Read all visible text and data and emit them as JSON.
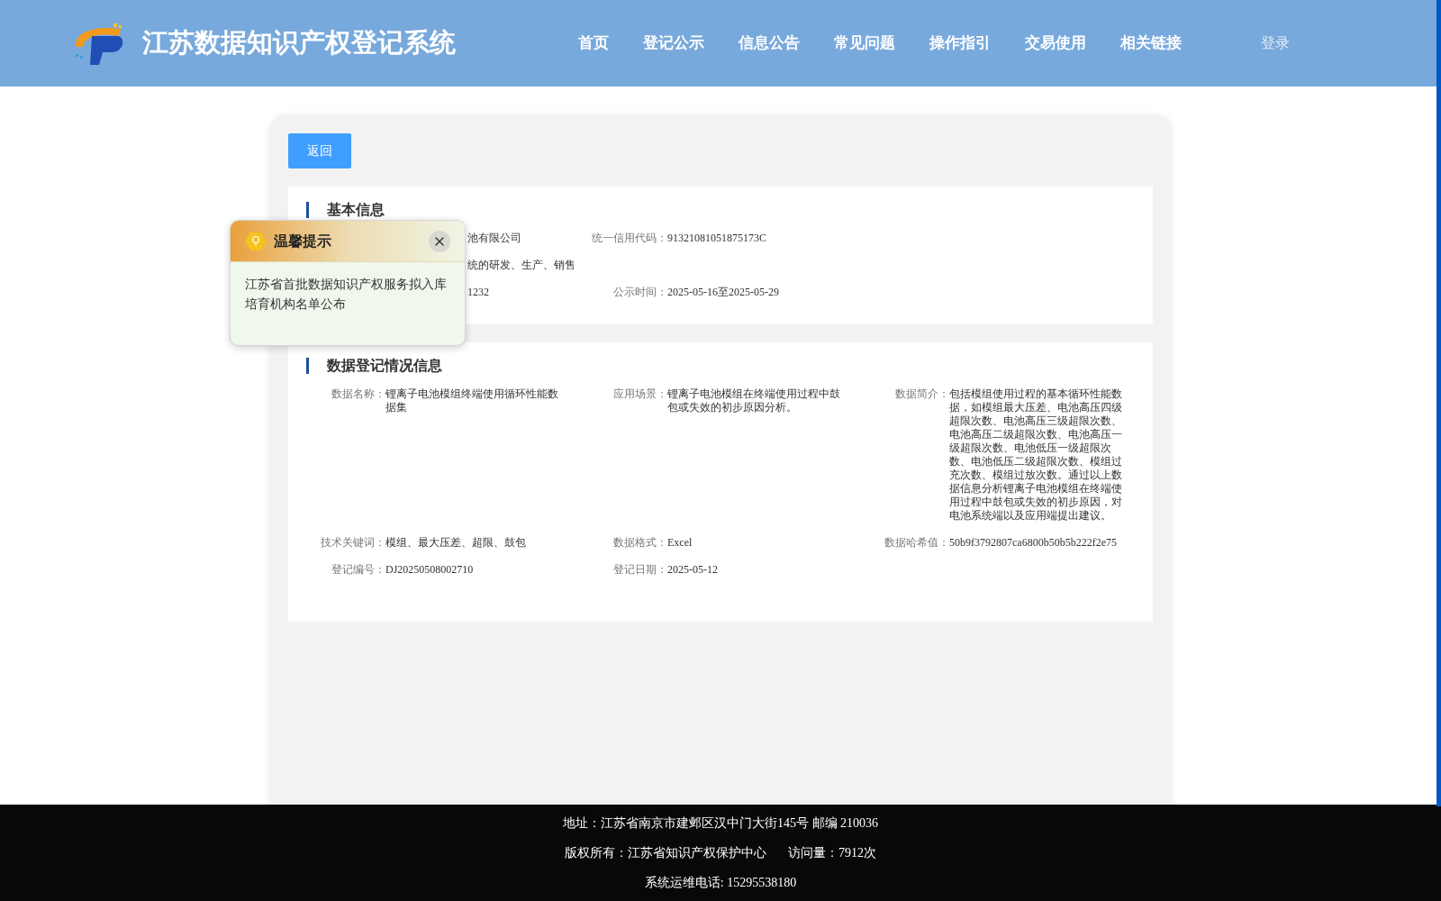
{
  "header": {
    "title": "江苏数据知识产权登记系统",
    "nav": [
      "首页",
      "登记公示",
      "信息公告",
      "常见问题",
      "操作指引",
      "交易使用",
      "相关链接"
    ],
    "login": "登录"
  },
  "back_button": "返回",
  "sections": [
    {
      "title": "基本信息",
      "rows": [
        [
          {
            "value": "池有限公司"
          },
          {
            "label": "统一信用代码：",
            "value": "91321081051875173C"
          }
        ],
        [
          {
            "value": "统的研发、生产、销售"
          }
        ],
        [
          {
            "value": "1232"
          },
          {
            "label": "公示时间：",
            "value": "2025-05-16至2025-05-29"
          }
        ]
      ]
    },
    {
      "title": "数据登记情况信息",
      "rows": [
        [
          {
            "label": "数据名称：",
            "value": "锂离子电池模组终端使用循环性能数据集"
          },
          {
            "label": "应用场景：",
            "value": "锂离子电池模组在终端使用过程中鼓包或失效的初步原因分析。"
          },
          {
            "label": "数据简介：",
            "value": "包括模组使用过程的基本循环性能数据，如模组最大压差、电池高压四级超限次数、电池高压三级超限次数、电池高压二级超限次数、电池高压一级超限次数、电池低压一级超限次数、电池低压二级超限次数、模组过充次数、模组过放次数。通过以上数据信息分析锂离子电池模组在终端使用过程中鼓包或失效的初步原因，对电池系统端以及应用端提出建议。"
          }
        ],
        [
          {
            "label": "技术关键词：",
            "value": "模组、最大压差、超限、鼓包"
          },
          {
            "label": "数据格式：",
            "value": "Excel"
          },
          {
            "label": "数据哈希值：",
            "value": "50b9f3792807ca6800b50b5b222f2e75"
          }
        ],
        [
          {
            "label": "登记编号：",
            "value": "DJ20250508002710"
          },
          {
            "label": "登记日期：",
            "value": "2025-05-12"
          }
        ]
      ]
    }
  ],
  "popup": {
    "title": "温馨提示",
    "message": "江苏省首批数据知识产权服务拟入库培育机构名单公布"
  },
  "footer": {
    "lines": [
      "地址：江苏省南京市建邺区汉中门大街145号 邮编 210036",
      "版权所有：江苏省知识产权保护中心",
      "访问量：7912次",
      "系统运维电话: 15295538180"
    ]
  }
}
